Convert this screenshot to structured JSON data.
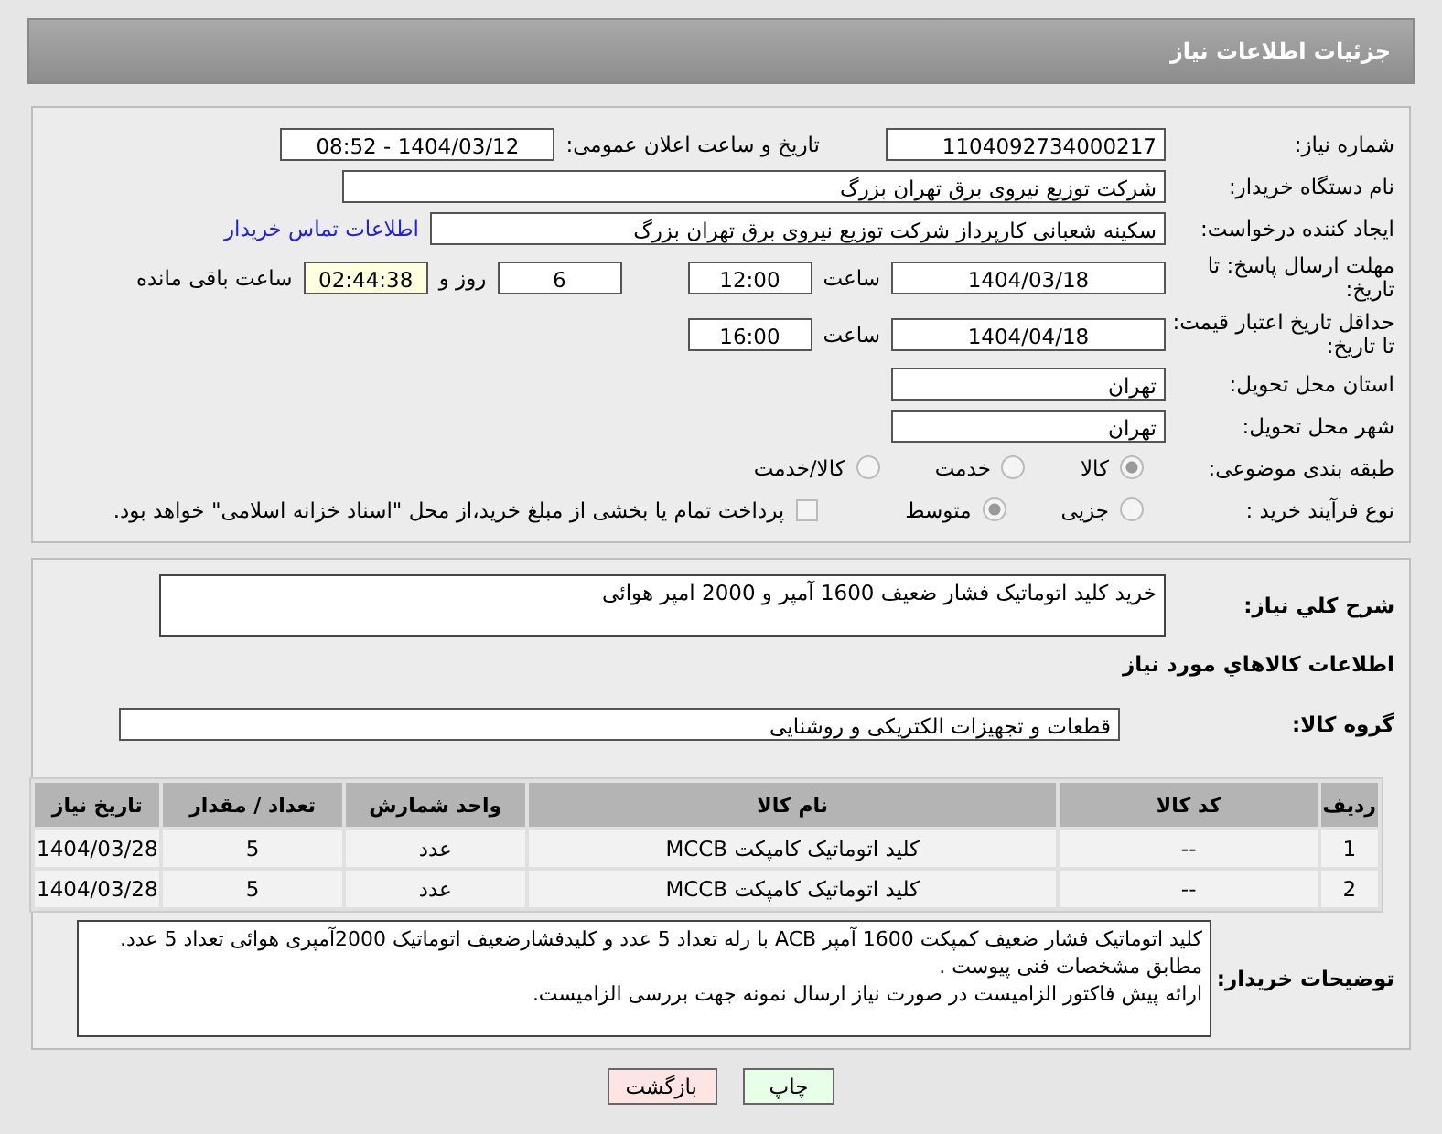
{
  "header": {
    "title": "جزئیات اطلاعات نیاز"
  },
  "need_number": {
    "label": "شماره نیاز:",
    "value": "1104092734000217"
  },
  "announce": {
    "label": "تاریخ و ساعت اعلان عمومی:",
    "value": "1404/03/12 - 08:52"
  },
  "buyer_org": {
    "label": "نام دستگاه خریدار:",
    "value": "شرکت توزیع نیروی برق تهران بزرگ"
  },
  "requester": {
    "label": "ایجاد کننده درخواست:",
    "value": "سکینه شعبانی کارپرداز شرکت توزیع نیروی برق تهران بزرگ",
    "link": "اطلاعات تماس خریدار"
  },
  "deadline": {
    "label": "مهلت ارسال پاسخ: تا تاریخ:",
    "date": "1404/03/18",
    "time_label": "ساعت",
    "time": "12:00",
    "days": "6",
    "days_label": "روز و",
    "remaining": "02:44:38",
    "remaining_label": "ساعت باقی مانده"
  },
  "validity": {
    "label": "حداقل تاریخ اعتبار قیمت: تا تاریخ:",
    "date": "1404/04/18",
    "time_label": "ساعت",
    "time": "16:00"
  },
  "province": {
    "label": "استان محل تحویل:",
    "value": "تهران"
  },
  "city": {
    "label": "شهر محل تحویل:",
    "value": "تهران"
  },
  "category": {
    "label": "طبقه بندی موضوعی:",
    "options": [
      {
        "label": "کالا",
        "selected": true
      },
      {
        "label": "خدمت",
        "selected": false
      },
      {
        "label": "کالا/خدمت",
        "selected": false
      }
    ]
  },
  "purchase_type": {
    "label": "نوع فرآیند خرید :",
    "options": [
      {
        "label": "جزیی",
        "selected": false
      },
      {
        "label": "متوسط",
        "selected": true
      }
    ],
    "treasury": {
      "label": "پرداخت تمام یا بخشی از مبلغ خرید،از محل \"اسناد خزانه اسلامی\" خواهد بود.",
      "checked": false
    }
  },
  "summary": {
    "label": "شرح کلي نياز:",
    "value": "خرید کلید اتوماتیک فشار ضعیف 1600 آمپر و 2000 امپر هوائی"
  },
  "goods_heading": "اطلاعات کالاهاي مورد نياز",
  "goods_group": {
    "label": "گروه کالا:",
    "value": "قطعات و تجهیزات الکتریکی و روشنایی"
  },
  "table": {
    "columns": [
      "ردیف",
      "کد کالا",
      "نام کالا",
      "واحد شمارش",
      "تعداد / مقدار",
      "تاریخ نیاز"
    ],
    "rows": [
      [
        "1",
        "--",
        "کلید اتوماتیک کامپکت MCCB",
        "عدد",
        "5",
        "1404/03/28"
      ],
      [
        "2",
        "--",
        "کلید اتوماتیک کامپکت MCCB",
        "عدد",
        "5",
        "1404/03/28"
      ]
    ]
  },
  "buyer_notes": {
    "label": "توضیحات خریدار:",
    "lines": [
      "کلید اتوماتیک فشار ضعیف کمپکت 1600 آمپر ACB با رله  تعداد 5 عدد و کلیدفشارضعیف اتوماتیک 2000آمپری هوائی تعداد 5 عدد.",
      "مطابق مشخصات فنی پیوست .",
      "ارائه پیش فاکتور الزامیست در صورت نیاز ارسال نمونه جهت بررسی الزامیست."
    ]
  },
  "buttons": [
    {
      "label": "چاپ",
      "kind": "print"
    },
    {
      "label": "بازگشت",
      "kind": "back"
    }
  ]
}
